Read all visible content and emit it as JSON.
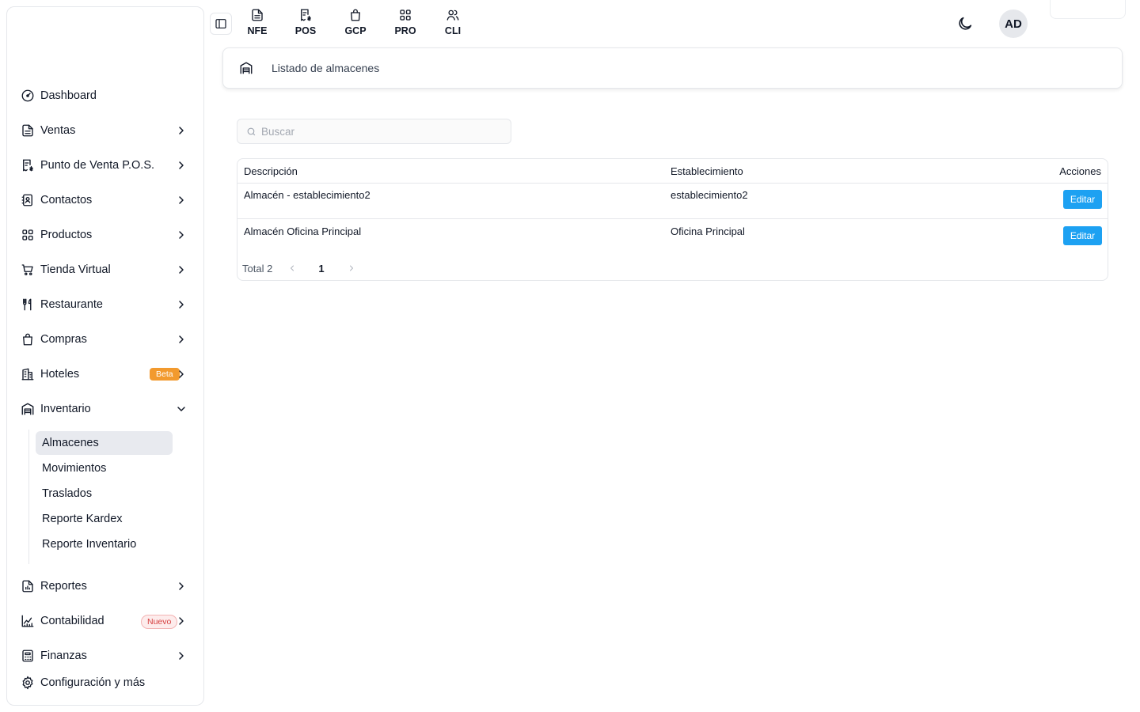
{
  "topbar": {
    "modules": [
      {
        "label": "NFE",
        "icon": "file-text-icon"
      },
      {
        "label": "POS",
        "icon": "receipt-icon"
      },
      {
        "label": "GCP",
        "icon": "shopping-bag-icon"
      },
      {
        "label": "PRO",
        "icon": "grid-icon"
      },
      {
        "label": "CLI",
        "icon": "users-icon"
      }
    ],
    "avatar_initials": "AD",
    "theme_icon": "moon-icon"
  },
  "sidebar": {
    "items": [
      {
        "label": "Dashboard",
        "icon": "dashboard-icon"
      },
      {
        "label": "Ventas",
        "icon": "file-text-icon"
      },
      {
        "label": "Punto de Venta P.O.S.",
        "icon": "receipt-icon"
      },
      {
        "label": "Contactos",
        "icon": "contacts-icon"
      },
      {
        "label": "Productos",
        "icon": "grid-icon"
      },
      {
        "label": "Tienda Virtual",
        "icon": "cart-icon"
      },
      {
        "label": "Restaurante",
        "icon": "utensils-icon"
      },
      {
        "label": "Compras",
        "icon": "shopping-bag-icon"
      },
      {
        "label": "Hoteles",
        "icon": "building-icon",
        "badge": "Beta"
      },
      {
        "label": "Inventario",
        "icon": "warehouse-icon",
        "expanded": true
      },
      {
        "label": "Reportes",
        "icon": "report-icon"
      },
      {
        "label": "Contabilidad",
        "icon": "chart-icon",
        "badge": "Nuevo"
      },
      {
        "label": "Finanzas",
        "icon": "calculator-icon"
      },
      {
        "label": "Configuración y más",
        "icon": "gear-icon"
      }
    ],
    "inventario_sub": [
      {
        "label": "Almacenes",
        "active": true
      },
      {
        "label": "Movimientos"
      },
      {
        "label": "Traslados"
      },
      {
        "label": "Reporte Kardex"
      },
      {
        "label": "Reporte Inventario"
      }
    ]
  },
  "breadcrumb": {
    "title": "Listado de almacenes",
    "icon": "warehouse-icon"
  },
  "search": {
    "placeholder": "Buscar",
    "value": ""
  },
  "table": {
    "columns": [
      "Descripción",
      "Establecimiento",
      "Acciones"
    ],
    "rows": [
      {
        "descripcion": "Almacén - establecimiento2",
        "establecimiento": "establecimiento2",
        "action": "Editar"
      },
      {
        "descripcion": "Almacén Oficina Principal",
        "establecimiento": "Oficina Principal",
        "action": "Editar"
      }
    ],
    "pagination": {
      "total_label": "Total 2",
      "current_page": "1"
    }
  },
  "colors": {
    "accent": "#1da1f2",
    "beta_badge": "#f29a2e",
    "nuevo_badge_text": "#d53f3f",
    "active_sub_bg": "#e8eaef"
  }
}
